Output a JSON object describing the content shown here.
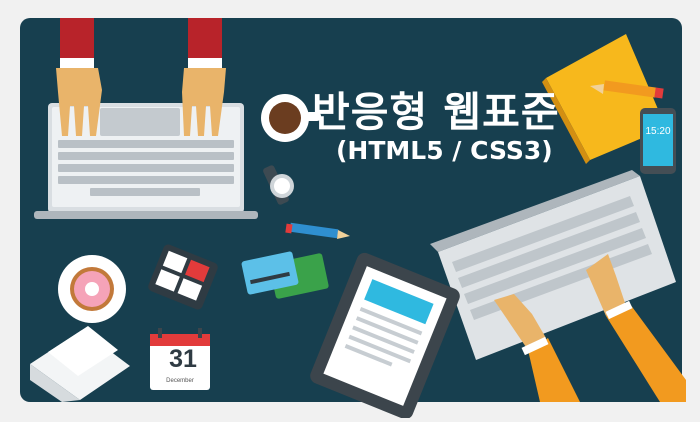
{
  "banner": {
    "title": "반응형 웹표준",
    "subtitle": "(HTML5 / CSS3)"
  },
  "calendar": {
    "day": "31",
    "month": "December"
  },
  "phone": {
    "time": "15:20"
  },
  "colors": {
    "board": "#173f4f",
    "background": "#f1f1f1",
    "sleeve_red": "#b8232a",
    "sleeve_orange": "#f29a1f",
    "skin": "#e9b46a",
    "notebook": "#f7b81c"
  }
}
